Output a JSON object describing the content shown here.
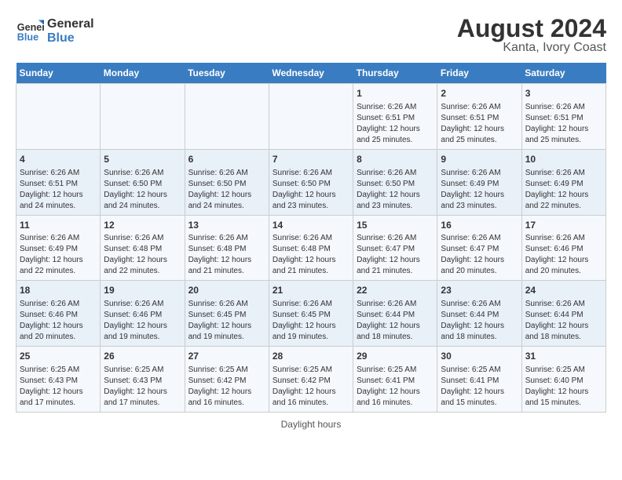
{
  "header": {
    "logo_text_general": "General",
    "logo_text_blue": "Blue",
    "title": "August 2024",
    "subtitle": "Kanta, Ivory Coast"
  },
  "calendar": {
    "days_of_week": [
      "Sunday",
      "Monday",
      "Tuesday",
      "Wednesday",
      "Thursday",
      "Friday",
      "Saturday"
    ],
    "weeks": [
      [
        {
          "day": "",
          "info": ""
        },
        {
          "day": "",
          "info": ""
        },
        {
          "day": "",
          "info": ""
        },
        {
          "day": "",
          "info": ""
        },
        {
          "day": "1",
          "info": "Sunrise: 6:26 AM\nSunset: 6:51 PM\nDaylight: 12 hours\nand 25 minutes."
        },
        {
          "day": "2",
          "info": "Sunrise: 6:26 AM\nSunset: 6:51 PM\nDaylight: 12 hours\nand 25 minutes."
        },
        {
          "day": "3",
          "info": "Sunrise: 6:26 AM\nSunset: 6:51 PM\nDaylight: 12 hours\nand 25 minutes."
        }
      ],
      [
        {
          "day": "4",
          "info": "Sunrise: 6:26 AM\nSunset: 6:51 PM\nDaylight: 12 hours\nand 24 minutes."
        },
        {
          "day": "5",
          "info": "Sunrise: 6:26 AM\nSunset: 6:50 PM\nDaylight: 12 hours\nand 24 minutes."
        },
        {
          "day": "6",
          "info": "Sunrise: 6:26 AM\nSunset: 6:50 PM\nDaylight: 12 hours\nand 24 minutes."
        },
        {
          "day": "7",
          "info": "Sunrise: 6:26 AM\nSunset: 6:50 PM\nDaylight: 12 hours\nand 23 minutes."
        },
        {
          "day": "8",
          "info": "Sunrise: 6:26 AM\nSunset: 6:50 PM\nDaylight: 12 hours\nand 23 minutes."
        },
        {
          "day": "9",
          "info": "Sunrise: 6:26 AM\nSunset: 6:49 PM\nDaylight: 12 hours\nand 23 minutes."
        },
        {
          "day": "10",
          "info": "Sunrise: 6:26 AM\nSunset: 6:49 PM\nDaylight: 12 hours\nand 22 minutes."
        }
      ],
      [
        {
          "day": "11",
          "info": "Sunrise: 6:26 AM\nSunset: 6:49 PM\nDaylight: 12 hours\nand 22 minutes."
        },
        {
          "day": "12",
          "info": "Sunrise: 6:26 AM\nSunset: 6:48 PM\nDaylight: 12 hours\nand 22 minutes."
        },
        {
          "day": "13",
          "info": "Sunrise: 6:26 AM\nSunset: 6:48 PM\nDaylight: 12 hours\nand 21 minutes."
        },
        {
          "day": "14",
          "info": "Sunrise: 6:26 AM\nSunset: 6:48 PM\nDaylight: 12 hours\nand 21 minutes."
        },
        {
          "day": "15",
          "info": "Sunrise: 6:26 AM\nSunset: 6:47 PM\nDaylight: 12 hours\nand 21 minutes."
        },
        {
          "day": "16",
          "info": "Sunrise: 6:26 AM\nSunset: 6:47 PM\nDaylight: 12 hours\nand 20 minutes."
        },
        {
          "day": "17",
          "info": "Sunrise: 6:26 AM\nSunset: 6:46 PM\nDaylight: 12 hours\nand 20 minutes."
        }
      ],
      [
        {
          "day": "18",
          "info": "Sunrise: 6:26 AM\nSunset: 6:46 PM\nDaylight: 12 hours\nand 20 minutes."
        },
        {
          "day": "19",
          "info": "Sunrise: 6:26 AM\nSunset: 6:46 PM\nDaylight: 12 hours\nand 19 minutes."
        },
        {
          "day": "20",
          "info": "Sunrise: 6:26 AM\nSunset: 6:45 PM\nDaylight: 12 hours\nand 19 minutes."
        },
        {
          "day": "21",
          "info": "Sunrise: 6:26 AM\nSunset: 6:45 PM\nDaylight: 12 hours\nand 19 minutes."
        },
        {
          "day": "22",
          "info": "Sunrise: 6:26 AM\nSunset: 6:44 PM\nDaylight: 12 hours\nand 18 minutes."
        },
        {
          "day": "23",
          "info": "Sunrise: 6:26 AM\nSunset: 6:44 PM\nDaylight: 12 hours\nand 18 minutes."
        },
        {
          "day": "24",
          "info": "Sunrise: 6:26 AM\nSunset: 6:44 PM\nDaylight: 12 hours\nand 18 minutes."
        }
      ],
      [
        {
          "day": "25",
          "info": "Sunrise: 6:25 AM\nSunset: 6:43 PM\nDaylight: 12 hours\nand 17 minutes."
        },
        {
          "day": "26",
          "info": "Sunrise: 6:25 AM\nSunset: 6:43 PM\nDaylight: 12 hours\nand 17 minutes."
        },
        {
          "day": "27",
          "info": "Sunrise: 6:25 AM\nSunset: 6:42 PM\nDaylight: 12 hours\nand 16 minutes."
        },
        {
          "day": "28",
          "info": "Sunrise: 6:25 AM\nSunset: 6:42 PM\nDaylight: 12 hours\nand 16 minutes."
        },
        {
          "day": "29",
          "info": "Sunrise: 6:25 AM\nSunset: 6:41 PM\nDaylight: 12 hours\nand 16 minutes."
        },
        {
          "day": "30",
          "info": "Sunrise: 6:25 AM\nSunset: 6:41 PM\nDaylight: 12 hours\nand 15 minutes."
        },
        {
          "day": "31",
          "info": "Sunrise: 6:25 AM\nSunset: 6:40 PM\nDaylight: 12 hours\nand 15 minutes."
        }
      ]
    ]
  },
  "footer": {
    "text": "Daylight hours"
  }
}
